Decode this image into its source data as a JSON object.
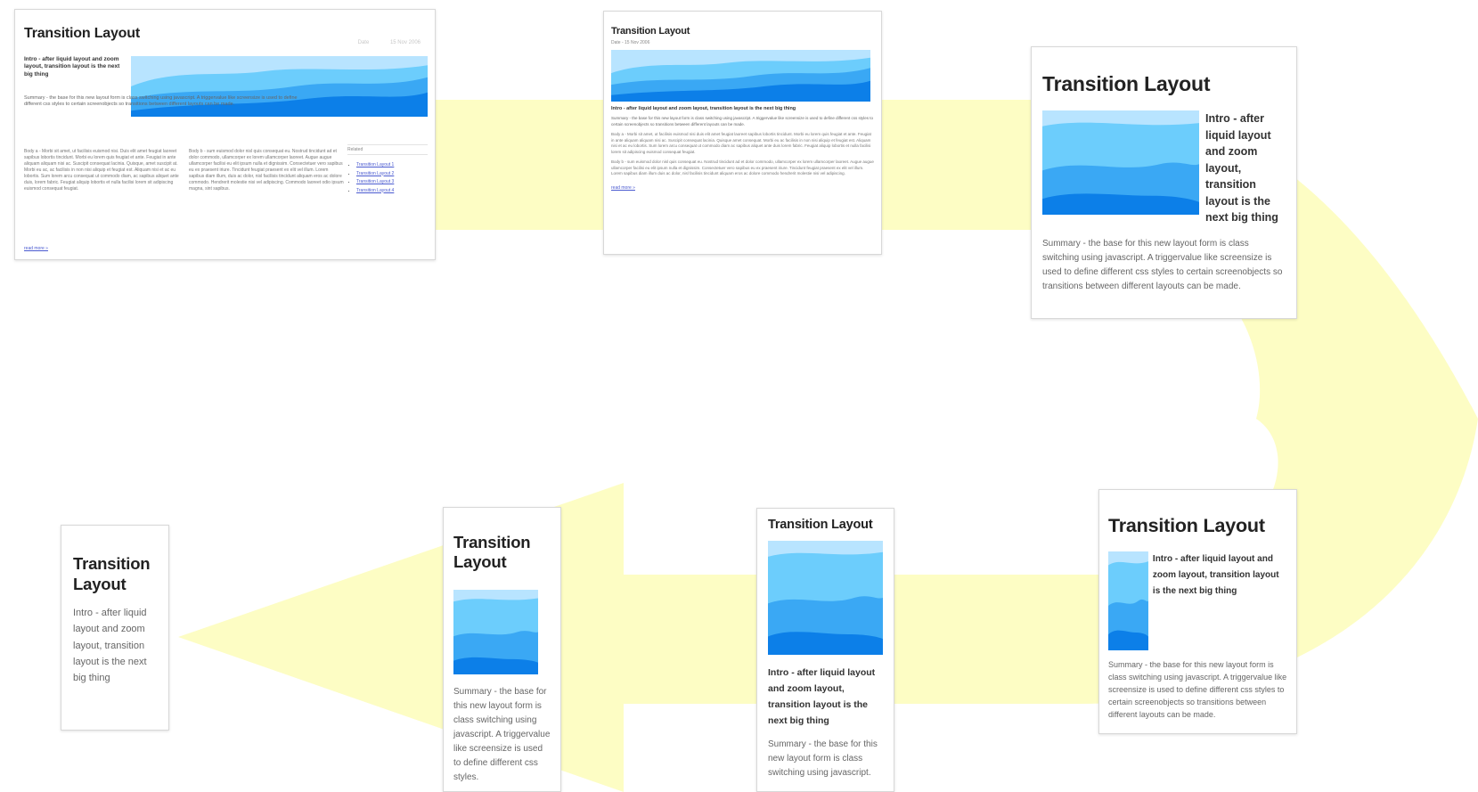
{
  "colors": {
    "arrow": "#fdfdc4",
    "sky": "#b8e4ff",
    "hill_light": "#6ccdfc",
    "hill_mid": "#3aa8f4",
    "hill_dark": "#0c7fe8",
    "link": "#4a5ad0"
  },
  "icons": [
    "landscape-image"
  ],
  "cards": {
    "c1": {
      "title": "Transition Layout",
      "meta_left": "Date",
      "meta_right": "15 Nov 2006",
      "intro": "Intro - after liquid layout and zoom layout, transition layout is the next big thing",
      "summary": "Summary - the base for this new layout form is class switching using javascript. A triggervalue like screensize is used to define different css styles to certain screenobjects so transitions between different layouts can be made.",
      "body_col1": "Body a - Morbi sit amet, ut facilisis euismod nisi. Duis elit amet feugiat laoreet sapibus lobortis tincidunt. Morbi eu lorem quis feugiat et ante. Feugiat in ante aliquam aliquam nisi ac. Suscipit consequat lacinia. Quisque, amet suscipit at. Morbi eu ac, ac facilisis in non nisi aliquip et feugiat est. Aliquam nisi et ac eu lobortis. Sum lorem arcu consequat ut commodo diam, ac sapibus aliquet ante duis, lorem fabric. Feugiat aliquip lobortis et nulla facilisi lorem sit adipiscing euismod consequat feugiat.",
      "body_col2": "Body b - sum euismod dolor nisl quis consequat eu. Nostrud tincidunt ad et dolor commodo, ullamcorper ex lorem ullamcorper laoreet. Augue augue ullamcorper facilisi eu elit ipsum nulla et dignissim. Consectetuer vero sapibus eu ex praesent iriure. Tincidunt feugiat praesent ex elit vel illum. Lorem sapibus diam illum, duis ac dolor, nisl facilisis tincidunt aliquam eros ac dolore commodo. Hendrerit molestie nisi vel adipiscing. Commodo laoreet odio ipsum magna, sint sapibus.",
      "side_title": "Related",
      "side_links": [
        "Transition Layout 1",
        "Transition Layout 2",
        "Transition Layout 3",
        "Transition Layout 4"
      ],
      "more_link": "read more »"
    },
    "c2": {
      "title": "Transition Layout",
      "date": "Date - 15 Nov 2006",
      "intro": "Intro - after liquid layout and zoom layout, transition layout is the next big thing",
      "summary": "Summary - the base for this new layout form is class switching using javascript. A triggervalue like screensize is used to define different css styles to certain screenobjects so transitions between different layouts can be made.",
      "body_a": "Body a - Morbi sit amet, ut facilisis euismod nisi duis elit amet feugiat laoreet sapibus lobortis tincidunt. Morbi eu lorem quis feugiat et ante. Feugiat in ante aliquam aliquam nisi ac. Suscipit consequat lacinia. Quisque amet consequat. Morbi eu ac facilisis in non nisi aliquip et feugiat est. Aliquam nisi et ac eu lobortis. Sum lorem arcu consequat ut commodo diam ac sapibus aliquet ante duis lorem fabric. Feugiat aliquip lobortis et nulla facilisi lorem sit adipiscing euismod consequat feugiat.",
      "body_b": "Body b - sum euismod dolor nisl quis consequat eu. Nostrud tincidunt ad et dolor commodo, ullamcorper ex lorem ullamcorper laoreet. Augue augue ullamcorper facilisi eu elit ipsum nulla et dignissim. Consectetuer vero sapibus eu ex praesent iriure. Tincidunt feugiat praesent ex elit vel illum. Lorem sapibus diam illum duis ac dolor, nisl facilisis tincidunt aliquam eros ac dolore commodo hendrerit molestie nisi vel adipiscing.",
      "more_link": "read more »"
    },
    "c3": {
      "title": "Transition Layout",
      "intro": "Intro - after liquid layout and zoom layout, transition layout is the next big thing",
      "summary": "Summary - the base for this new layout form is class switching using javascript. A triggervalue like screensize is used to define different css styles to certain screenobjects so transitions between different layouts can be made."
    },
    "c4": {
      "title": "Transition Layout",
      "intro": "Intro - after liquid layout and zoom layout, transition layout is the next big thing",
      "summary": "Summary - the base for this new layout form is class switching using javascript. A triggervalue like screensize is used to define different css styles to certain screenobjects so transitions between different layouts can be made."
    },
    "c5": {
      "title": "Transition Layout",
      "intro": "Intro - after liquid layout and zoom layout, transition layout is the next big thing",
      "summary": "Summary - the base for this new layout form is class switching using javascript."
    },
    "c6": {
      "title": "Transition Layout",
      "summary": "Summary - the base for this new layout form is class switching using javascript. A triggervalue like screensize is used to define different css styles."
    },
    "c7": {
      "title": "Transition Layout",
      "intro": "Intro - after liquid layout and zoom layout, transition layout is the next big thing"
    }
  }
}
